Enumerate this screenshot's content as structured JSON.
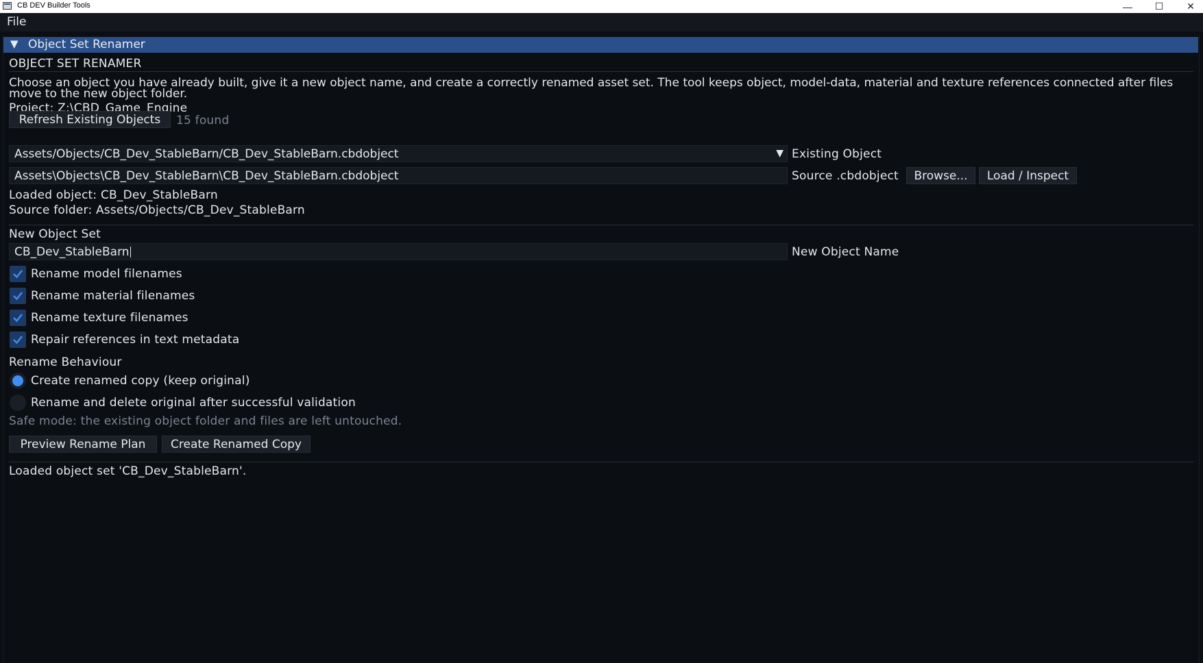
{
  "window": {
    "title": "CB DEV Builder Tools"
  },
  "menu": {
    "file_label": "File"
  },
  "header": {
    "label": "Object Set Renamer"
  },
  "section": {
    "title": "OBJECT SET RENAMER",
    "description": "Choose an object you have already built, give it a new object name, and create a correctly renamed asset set. The tool keeps object, model-data, material and texture references connected after files move to the new object folder."
  },
  "project": {
    "label": "Project: Z:\\CBD_Game_Engine"
  },
  "existing": {
    "refresh_label": "Refresh Existing Objects",
    "found_count": "15 found",
    "combo_value": "Assets/Objects/CB_Dev_StableBarn/CB_Dev_StableBarn.cbdobject",
    "combo_label": "Existing Object"
  },
  "source": {
    "path_value": "Assets\\Objects\\CB_Dev_StableBarn\\CB_Dev_StableBarn.cbdobject",
    "label": "Source .cbdobject",
    "browse_label": "Browse...",
    "load_label": "Load / Inspect",
    "loaded_object": "Loaded object: CB_Dev_StableBarn",
    "source_folder": "Source folder: Assets/Objects/CB_Dev_StableBarn"
  },
  "new_set": {
    "title": "New Object Set",
    "name_value": "CB_Dev_StableBarn",
    "name_label": "New Object Name"
  },
  "options": [
    {
      "label": "Rename model filenames",
      "checked": true
    },
    {
      "label": "Rename material filenames",
      "checked": true
    },
    {
      "label": "Rename texture filenames",
      "checked": true
    },
    {
      "label": "Repair references in text metadata",
      "checked": true
    }
  ],
  "behaviour": {
    "title": "Rename Behaviour",
    "options": [
      {
        "label": "Create renamed copy (keep original)",
        "selected": true
      },
      {
        "label": "Rename and delete original after successful validation",
        "selected": false
      }
    ],
    "note": "Safe mode: the existing object folder and files are left untouched."
  },
  "actions": {
    "preview_label": "Preview Rename Plan",
    "create_label": "Create Renamed Copy"
  },
  "status": {
    "message": "Loaded object set 'CB_Dev_StableBarn'."
  },
  "colors": {
    "accent": "#2a4f8b",
    "checkbox_bg": "#1d3a66",
    "radio_dot": "#3d8ef5",
    "background": "#0b0e13"
  }
}
